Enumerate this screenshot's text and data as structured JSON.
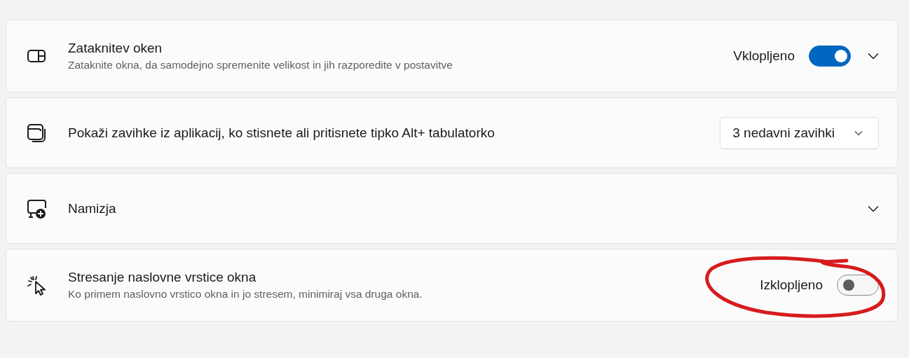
{
  "settings": [
    {
      "title": "Zataknitev oken",
      "description": "Zataknite okna, da samodejno spremenite velikost in jih razporedite v postavitve",
      "control": {
        "kind": "toggle",
        "on": true,
        "label": "Vklopljeno"
      },
      "expandable": true
    },
    {
      "title": "Pokaži zavihke iz aplikacij, ko stisnete ali pritisnete tipko Alt+ tabulatorko",
      "control": {
        "kind": "dropdown",
        "value": "3 nedavni zavihki"
      },
      "expandable": false
    },
    {
      "title": "Namizja",
      "expandable": true
    },
    {
      "title": "Stresanje naslovne vrstice okna",
      "description": "Ko primem naslovno vrstico okna in jo stresem, minimiraj vsa druga okna.",
      "control": {
        "kind": "toggle",
        "on": false,
        "label": "Izklopljeno"
      },
      "expandable": false
    }
  ]
}
